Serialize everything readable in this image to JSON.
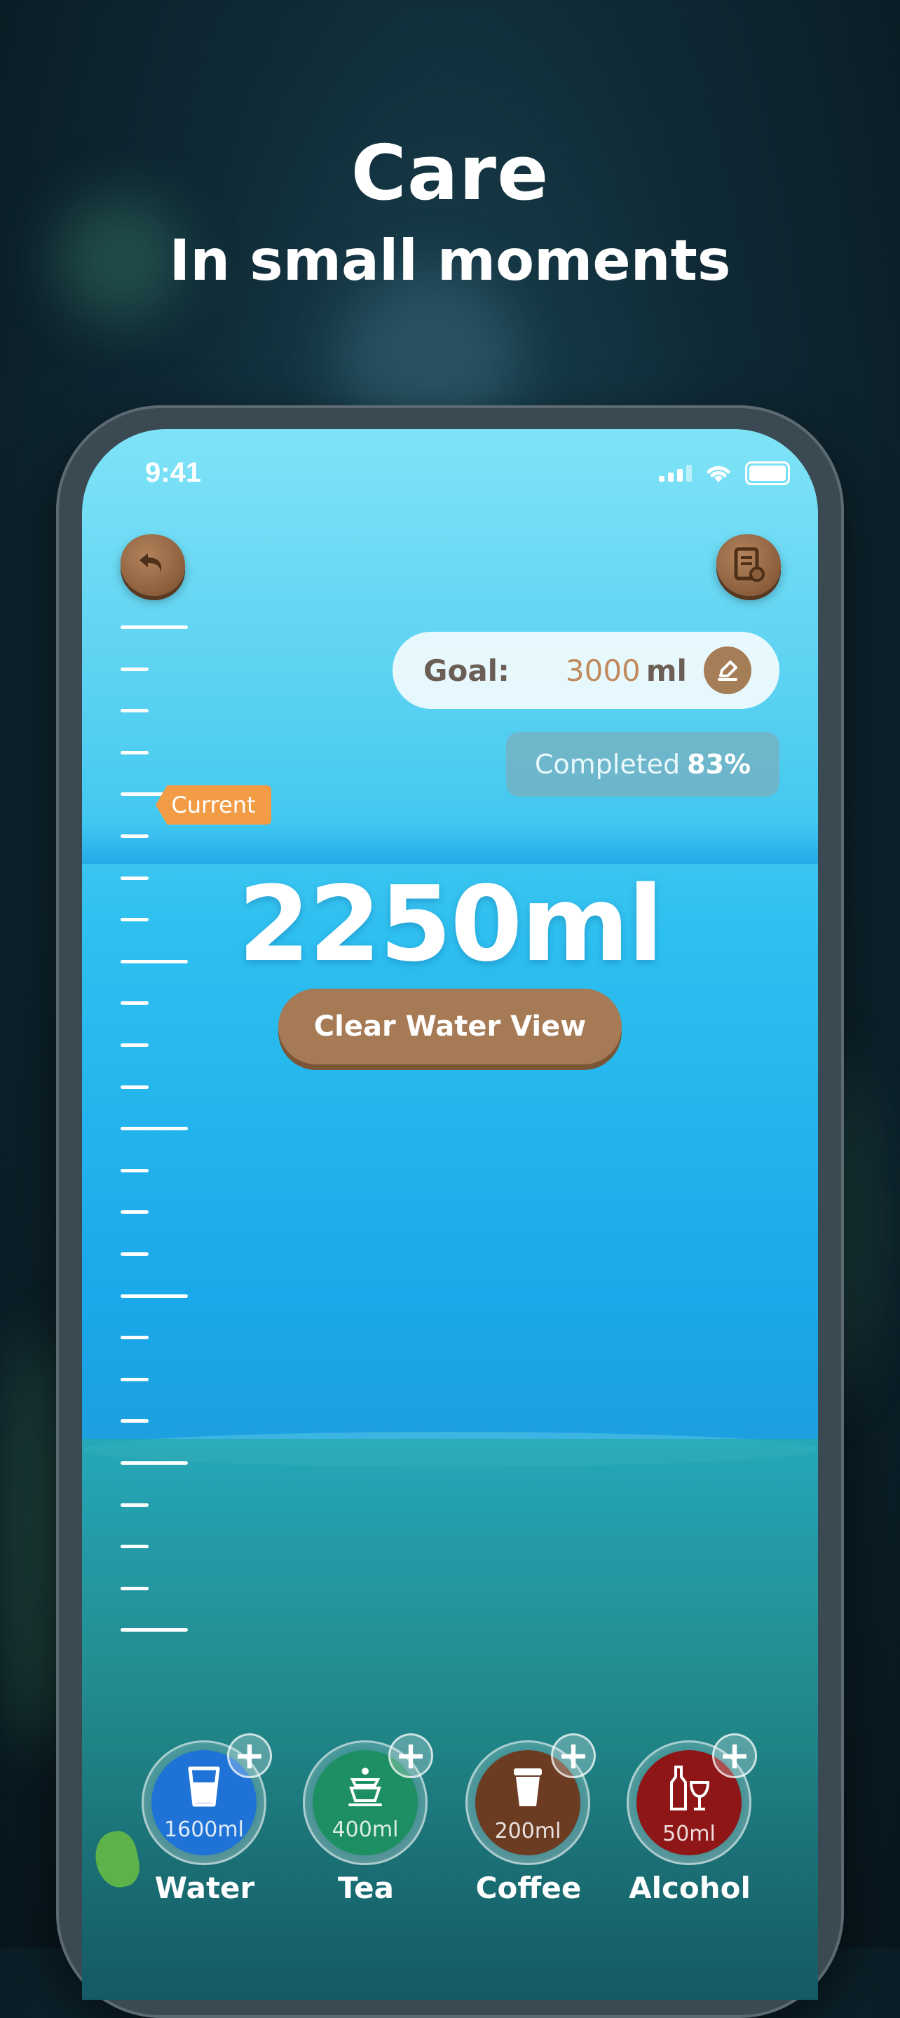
{
  "hero": {
    "title": "Care",
    "subtitle": "In small moments"
  },
  "status_bar": {
    "time": "9:41"
  },
  "header": {
    "back_icon": "back-arrow-icon",
    "log_icon": "report-icon"
  },
  "goal": {
    "label": "Goal:",
    "value": "3000",
    "unit": "ml",
    "edit_icon": "pencil-icon"
  },
  "progress": {
    "completed_label": "Completed",
    "completed_value": "83%",
    "current_tag": "Current",
    "fraction": 0.83
  },
  "amount": "2250ml",
  "clear_button": "Clear Water View",
  "drinks": [
    {
      "name": "Water",
      "amount": "1600ml",
      "color": "#1f73d6",
      "icon": "glass-icon"
    },
    {
      "name": "Tea",
      "amount": "400ml",
      "color": "#1e8f62",
      "icon": "teapot-icon"
    },
    {
      "name": "Coffee",
      "amount": "200ml",
      "color": "#6b3b22",
      "icon": "coffee-cup-icon"
    },
    {
      "name": "Alcohol",
      "amount": "50ml",
      "color": "#8e1616",
      "icon": "wine-icon"
    }
  ],
  "colors": {
    "accent": "#f29c46",
    "wood": "#a57a55",
    "water": "#2ec0f0"
  }
}
